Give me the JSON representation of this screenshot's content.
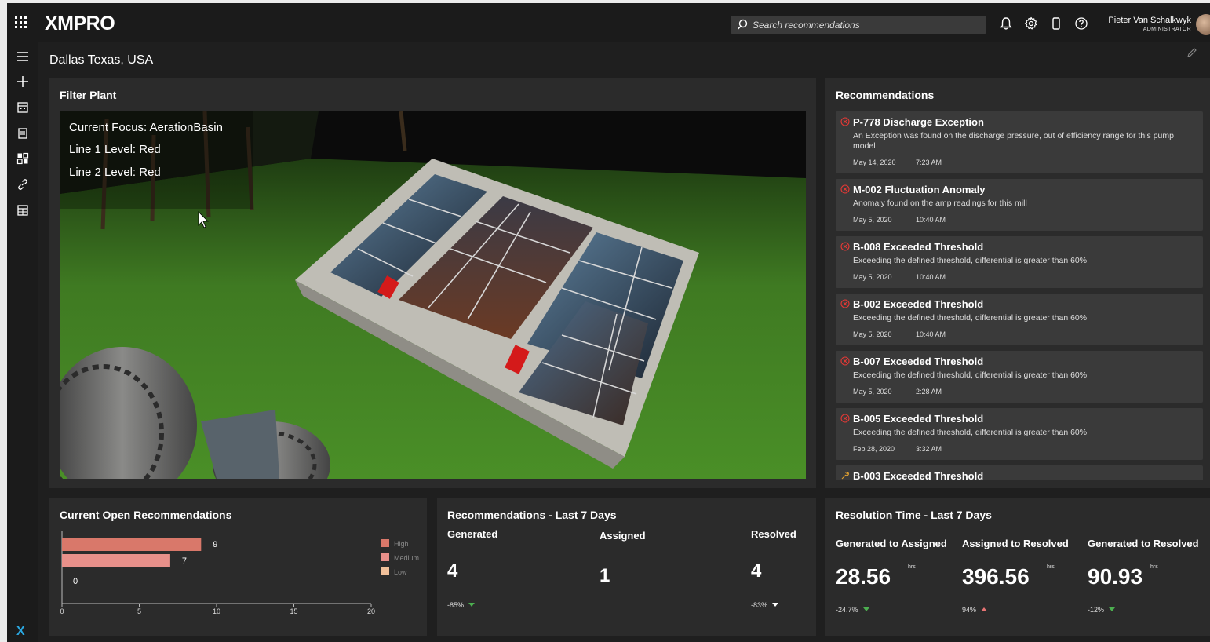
{
  "app": {
    "name": "XMPRO"
  },
  "header": {
    "search_placeholder": "Search recommendations",
    "user_name": "Pieter Van Schalkwyk",
    "user_role": "ADMINISTRATOR"
  },
  "page": {
    "title": "Dallas Texas, USA"
  },
  "filter_plant": {
    "title": "Filter Plant",
    "overlay": {
      "focus": "Current Focus: AerationBasin",
      "line1": "Line 1 Level: Red",
      "line2": "Line 2 Level: Red"
    }
  },
  "recommendations": {
    "title": "Recommendations",
    "items": [
      {
        "title": "P-778 Discharge Exception",
        "description": "An Exception was found on the discharge pressure, out of efficiency range for this pump model",
        "date": "May 14, 2020",
        "time": "7:23 AM",
        "icon": "error-circle-icon"
      },
      {
        "title": "M-002 Fluctuation Anomaly",
        "description": "Anomaly found on the amp readings for this mill",
        "date": "May 5, 2020",
        "time": "10:40 AM",
        "icon": "error-circle-icon"
      },
      {
        "title": "B-008 Exceeded Threshold",
        "description": "Exceeding the defined threshold, differential is greater than 60%",
        "date": "May 5, 2020",
        "time": "10:40 AM",
        "icon": "error-circle-icon"
      },
      {
        "title": "B-002 Exceeded Threshold",
        "description": "Exceeding the defined threshold, differential is greater than 60%",
        "date": "May 5, 2020",
        "time": "10:40 AM",
        "icon": "error-circle-icon"
      },
      {
        "title": "B-007 Exceeded Threshold",
        "description": "Exceeding the defined threshold, differential is greater than 60%",
        "date": "May 5, 2020",
        "time": "2:28 AM",
        "icon": "error-circle-icon"
      },
      {
        "title": "B-005 Exceeded Threshold",
        "description": "Exceeding the defined threshold, differential is greater than 60%",
        "date": "Feb 28, 2020",
        "time": "3:32 AM",
        "icon": "error-circle-icon"
      },
      {
        "title": "B-003 Exceeded Threshold",
        "description": "",
        "date": "",
        "time": "",
        "icon": "wrench-icon"
      }
    ]
  },
  "open_recs": {
    "title": "Current Open Recommendations",
    "legend": [
      "High",
      "Medium",
      "Low"
    ]
  },
  "chart_data": {
    "type": "bar",
    "orientation": "horizontal",
    "categories": [
      "High",
      "Medium",
      "Low"
    ],
    "values": [
      9,
      7,
      0
    ],
    "colors": [
      "#d9786a",
      "#e8908a",
      "#f1c09a"
    ],
    "x_ticks": [
      "0",
      "5",
      "10",
      "15",
      "20"
    ],
    "xlim": [
      0,
      20
    ],
    "legend_position": "right"
  },
  "last7": {
    "title": "Recommendations - Last 7 Days",
    "generated": {
      "label": "Generated",
      "value": "4",
      "change": "-85%"
    },
    "assigned": {
      "label": "Assigned",
      "value": "1"
    },
    "resolved": {
      "label": "Resolved",
      "value": "4",
      "change": "-83%"
    }
  },
  "resolution": {
    "title": "Resolution Time - Last 7 Days",
    "unit": "hrs",
    "gen_to_assigned": {
      "label": "Generated to Assigned",
      "value": "28.56",
      "change": "-24.7%"
    },
    "assigned_to_resolved": {
      "label": "Assigned to Resolved",
      "value": "396.56",
      "change": "94%"
    },
    "gen_to_resolved": {
      "label": "Generated to Resolved",
      "value": "90.93",
      "change": "-12%"
    }
  },
  "colors": {
    "accent": "#2aa7e0",
    "error": "#e53935",
    "down_good": "#4caf50",
    "up_bad": "#e57373"
  }
}
